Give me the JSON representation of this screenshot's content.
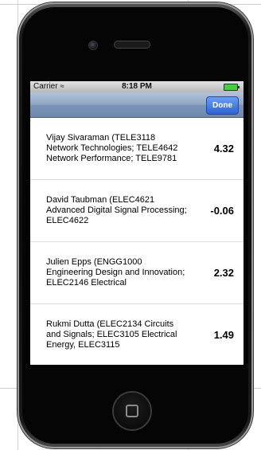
{
  "status_bar": {
    "carrier": "Carrier",
    "time": "8:18 PM"
  },
  "navbar": {
    "done_label": "Done"
  },
  "items": [
    {
      "text": "Vijay Sivaraman (TELE3118 Network Technologies; TELE4642 Network Performance; TELE9781",
      "score": "4.32"
    },
    {
      "text": "David Taubman (ELEC4621 Advanced Digital Signal Processing; ELEC4622",
      "score": "-0.06"
    },
    {
      "text": "Julien Epps (ENGG1000 Engineering Design and Innovation; ELEC2146 Electrical",
      "score": "2.32"
    },
    {
      "text": "Rukmi Dutta (ELEC2134 Circuits and Signals; ELEC3105 Electrical Energy, ELEC3115",
      "score": "1.49"
    }
  ],
  "icons": [
    "wifi-icon",
    "battery-icon",
    "camera-icon",
    "speaker-icon",
    "home-button-icon"
  ],
  "colors": {
    "done_button": "#2c63d6",
    "navbar": "#8ea5c3",
    "battery": "#3fd13f"
  }
}
